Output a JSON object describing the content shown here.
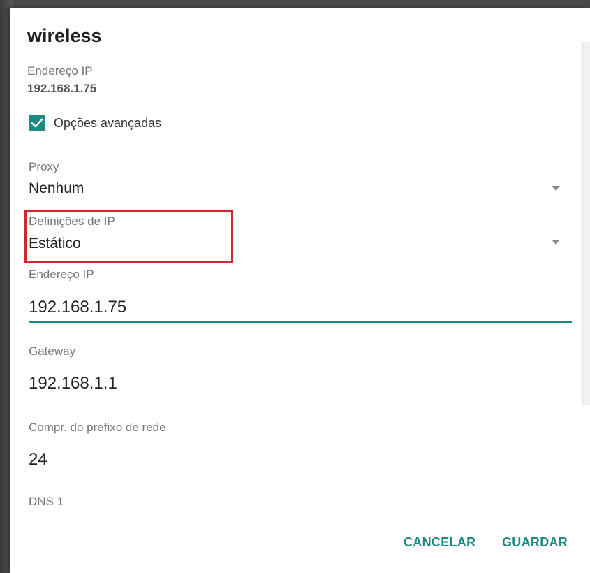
{
  "dialog": {
    "title": "wireless",
    "ip_info_label": "Endereço IP",
    "ip_info_value": "192.168.1.75",
    "advanced_checkbox": {
      "label": "Opções avançadas",
      "checked": true
    },
    "proxy": {
      "label": "Proxy",
      "value": "Nenhum"
    },
    "ip_settings": {
      "label": "Definições de IP",
      "value": "Estático"
    },
    "fields": [
      {
        "label": "Endereço IP",
        "value": "192.168.1.75"
      },
      {
        "label": "Gateway",
        "value": "192.168.1.1"
      },
      {
        "label": "Compr. do prefixo de rede",
        "value": "24"
      },
      {
        "label": "DNS 1",
        "value": ""
      }
    ],
    "buttons": {
      "cancel": "CANCELAR",
      "save": "GUARDAR"
    }
  },
  "colors": {
    "accent": "#1f8a84",
    "highlight": "#d0262c"
  }
}
